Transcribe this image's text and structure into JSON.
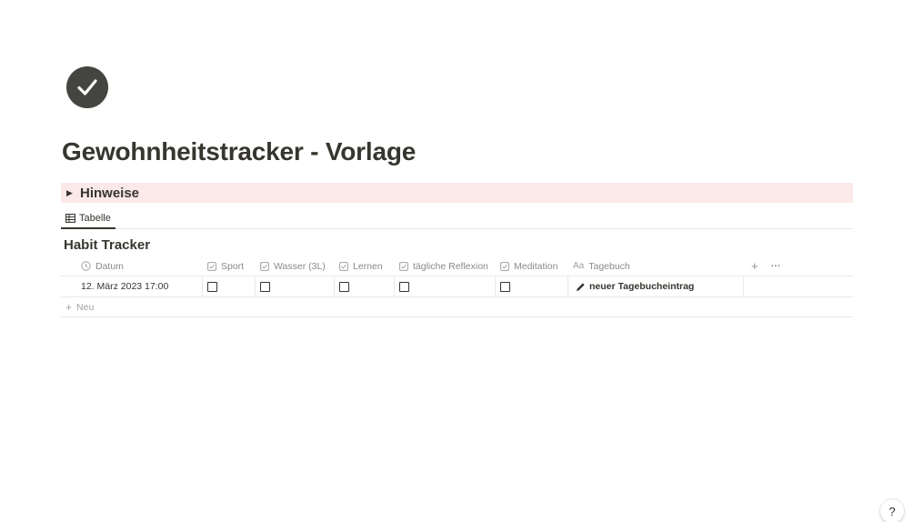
{
  "page": {
    "icon": "checkmark-circle-icon",
    "title": "Gewohnheitstracker - Vorlage"
  },
  "callout": {
    "label": "Hinweise",
    "background": "#fbe9e7",
    "icon": "toggle-triangle-icon"
  },
  "view": {
    "tab_label": "Tabelle",
    "tab_icon": "table-icon"
  },
  "database": {
    "title": "Habit Tracker",
    "columns": [
      {
        "label": "Datum",
        "icon": "clock-icon"
      },
      {
        "label": "Sport",
        "icon": "checkbox-property-icon"
      },
      {
        "label": "Wasser (3L)",
        "icon": "checkbox-property-icon"
      },
      {
        "label": "Lernen",
        "icon": "checkbox-property-icon"
      },
      {
        "label": "tägliche Reflexion",
        "icon": "checkbox-property-icon"
      },
      {
        "label": "Meditation",
        "icon": "checkbox-property-icon"
      },
      {
        "label": "Tagebuch",
        "icon": "Aa"
      }
    ],
    "add_column_label": "+",
    "more_label": "···",
    "rows": [
      {
        "datum": "12. März 2023 17:00",
        "sport": false,
        "wasser": false,
        "lernen": false,
        "reflexion": false,
        "meditation": false,
        "tagebuch": "neuer Tagebucheintrag",
        "tagebuch_icon": "pencil-icon"
      }
    ],
    "new_label": "Neu"
  },
  "help": {
    "label": "?"
  },
  "colors": {
    "text": "#37352f",
    "muted": "#8c8a86",
    "border": "#e9e9e7",
    "icon_bg": "#444440"
  }
}
